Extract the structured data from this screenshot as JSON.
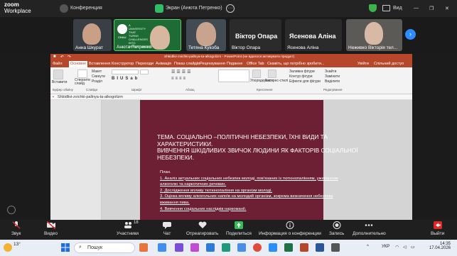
{
  "zoom": {
    "logo_line1": "zoom",
    "logo_line2": "Workplace",
    "meeting_label": "Конференция",
    "screen_share_label": "Экран (Анюта Петренко)",
    "view_label": "Вид",
    "minimize_glyph": "—",
    "restore_glyph": "❐",
    "close_glyph": "✕",
    "shield_icon": "shield-check-icon"
  },
  "participants": [
    {
      "name": "Анна Шкурат"
    },
    {
      "name": "Анюта Петренко",
      "banner": "A UNIVERSITY THAT TURNS CHALLENGES INTO OPPORTUNITIES",
      "banner_mark": "CHAU"
    },
    {
      "name": "Тетяна Кукоба"
    },
    {
      "name": "Віктор Опара",
      "big": "Віктор Опара"
    },
    {
      "name": "Ясенова Аліна",
      "big": "Ясенова Аліна"
    },
    {
      "name": "Неживко Вікторія тел..."
    }
  ],
  "powerpoint": {
    "title": "Shkidlivi-zvichki-pallnya-ta-alkogolizm - PowerPoint (не вдалося активувати продукт)",
    "menu": [
      "Файл",
      "Основне",
      "Вставлення",
      "Конструктор",
      "Переходи",
      "Анімація",
      "Показ слайдів",
      "Рецензування",
      "Подання",
      "Office Tab",
      "Скажіть, що потрібно зробити...",
      "Увійти",
      "Спільний доступ"
    ],
    "ribbon_groups": [
      "Буфер обміну",
      "Слайди",
      "Шрифт",
      "Абзац",
      "Креслення",
      "Редагування"
    ],
    "ribbon_labels": {
      "paste": "Вставити",
      "new_slide": "Створити слайд",
      "layout": "Макет",
      "reset": "Скинути",
      "section": "Розділ",
      "arrange": "Упорядкувати",
      "styles": "Експрес-стилі",
      "fill": "Заливка фігури",
      "outline": "Контур фігури",
      "effects": "Ефекти для фігури",
      "find": "Знайти",
      "replace": "Замінити",
      "select": "Виділити"
    },
    "doc_tab": "Shkidlivi-zvichki-pallnya-ta-alkogolizm",
    "slide": {
      "title_lines": [
        "ТЕМА. СОЦІАЛЬНО –ПОЛІТИЧНІ НЕБЕЗПЕКИ, ЇХНІ ВИДИ ТА",
        "ХАРАКТЕРИСТИКИ.",
        "ВИВЧЕННЯ ШКІДЛИВИХ ЗВИЧОК ЛЮДИНИ ЯК ФАКТОРІВ СОЦІАЛЬНОЇ",
        "НЕБЕЗПЕКИ."
      ],
      "plan_heading": "План.",
      "plan_items": [
        "1. Аналіз актуальних соціальних небезпек молоді, пов’язаних із тютюнопалінням, уживанням",
        "алкоголю та наркотичних речовин.",
        "2. Дослідження впливу тютюнопаління на організм молоді.",
        "3. Оцінка впливу алкогольних напоїв на молодий організм, зокрема визначення небезпеки",
        "вживання пива.",
        "4. Вивчення соціальних наслідків наркоманії."
      ]
    }
  },
  "controls": {
    "audio": "Звук",
    "video": "Видео",
    "participants": "Участники",
    "participants_count": "18",
    "chat": "Чат",
    "react": "Отреагировать",
    "share": "Поделиться",
    "info": "Информация о конференции",
    "record": "Запись",
    "more": "Дополнительно",
    "leave": "Выйти"
  },
  "taskbar": {
    "weather_temp": "13°",
    "search_placeholder": "Пошук",
    "lang": "УКР",
    "time": "14:35",
    "date": "17.04.2026"
  },
  "colors": {
    "ppt_accent": "#b7472a",
    "slide_bg": "#6d1f33",
    "zoom_blue": "#2d8cff",
    "leave_red": "#e02828"
  }
}
